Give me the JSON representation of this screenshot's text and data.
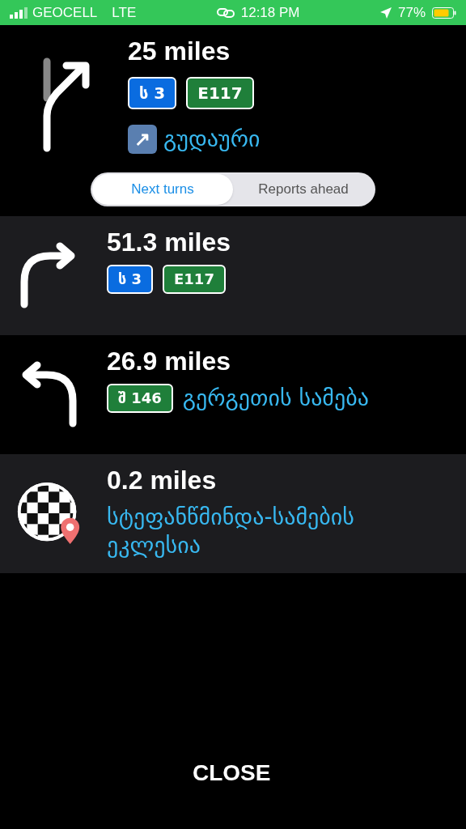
{
  "status_bar": {
    "carrier": "GEOCELL",
    "network": "LTE",
    "time": "12:18 PM",
    "battery": "77%"
  },
  "current_turn": {
    "kind": "slight-right",
    "distance": "25 miles",
    "shields": [
      {
        "label": "ს 3",
        "kind": "blue"
      },
      {
        "label": "E117",
        "kind": "green"
      }
    ],
    "exit_icon": "↗",
    "destination": "გუდაური"
  },
  "tabs": [
    {
      "label": "Next turns",
      "selected": true
    },
    {
      "label": "Reports ahead",
      "selected": false
    }
  ],
  "turns": [
    {
      "kind": "right",
      "distance": "51.3 miles",
      "shields": [
        {
          "label": "ს 3",
          "kind": "blue"
        },
        {
          "label": "E117",
          "kind": "green"
        }
      ]
    },
    {
      "kind": "left",
      "distance": "26.9 miles",
      "shields": [
        {
          "label": "შ 146",
          "kind": "green"
        }
      ],
      "street": "გერგეთის სამება"
    },
    {
      "kind": "destination",
      "distance": "0.2 miles",
      "street": "სტეფანწმინდა-სამების ეკლესია"
    }
  ],
  "close_button": "CLOSE"
}
